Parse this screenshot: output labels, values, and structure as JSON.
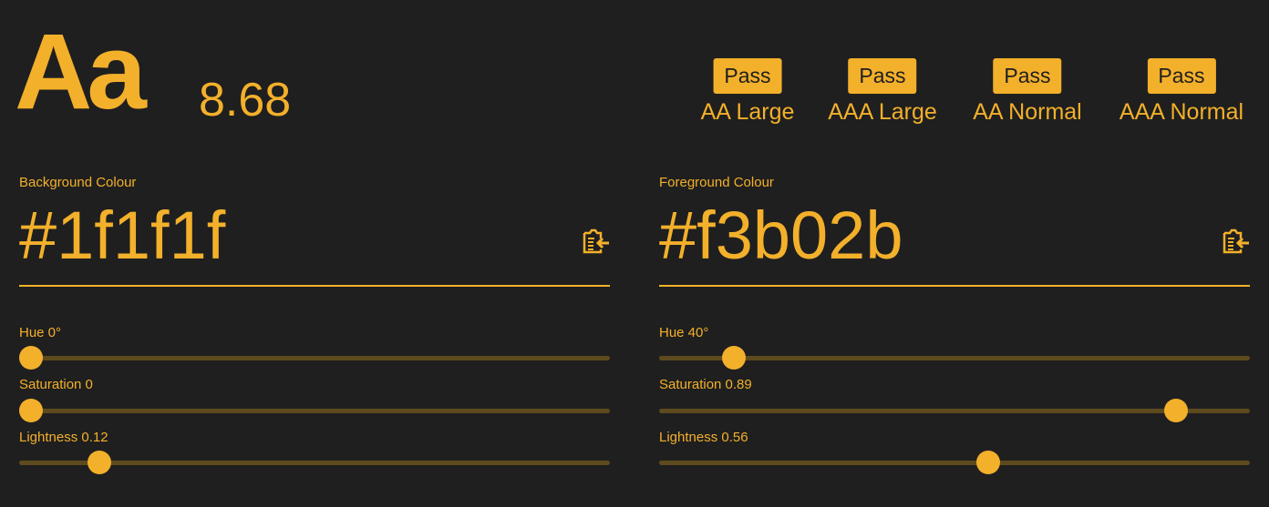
{
  "preview": {
    "sample": "Aa",
    "contrast_ratio": "8.68"
  },
  "checks": [
    {
      "badge": "Pass",
      "level": "AA Large"
    },
    {
      "badge": "Pass",
      "level": "AAA Large"
    },
    {
      "badge": "Pass",
      "level": "AA Normal"
    },
    {
      "badge": "Pass",
      "level": "AAA Normal"
    }
  ],
  "background": {
    "label": "Background Colour",
    "hex": "#1f1f1f",
    "sliders": [
      {
        "label": "Hue 0°",
        "fraction": 0
      },
      {
        "label": "Saturation 0",
        "fraction": 0
      },
      {
        "label": "Lightness 0.12",
        "fraction": 0.12
      }
    ]
  },
  "foreground": {
    "label": "Foreground Colour",
    "hex": "#f3b02b",
    "sliders": [
      {
        "label": "Hue 40°",
        "fraction": 0.111
      },
      {
        "label": "Saturation 0.89",
        "fraction": 0.89
      },
      {
        "label": "Lightness 0.56",
        "fraction": 0.56
      }
    ]
  },
  "colors": {
    "accent": "#f3b02b",
    "bg": "#1f1f1f",
    "track": "#5e4b1d"
  },
  "icons": {
    "paste": "clipboard-paste-icon"
  }
}
